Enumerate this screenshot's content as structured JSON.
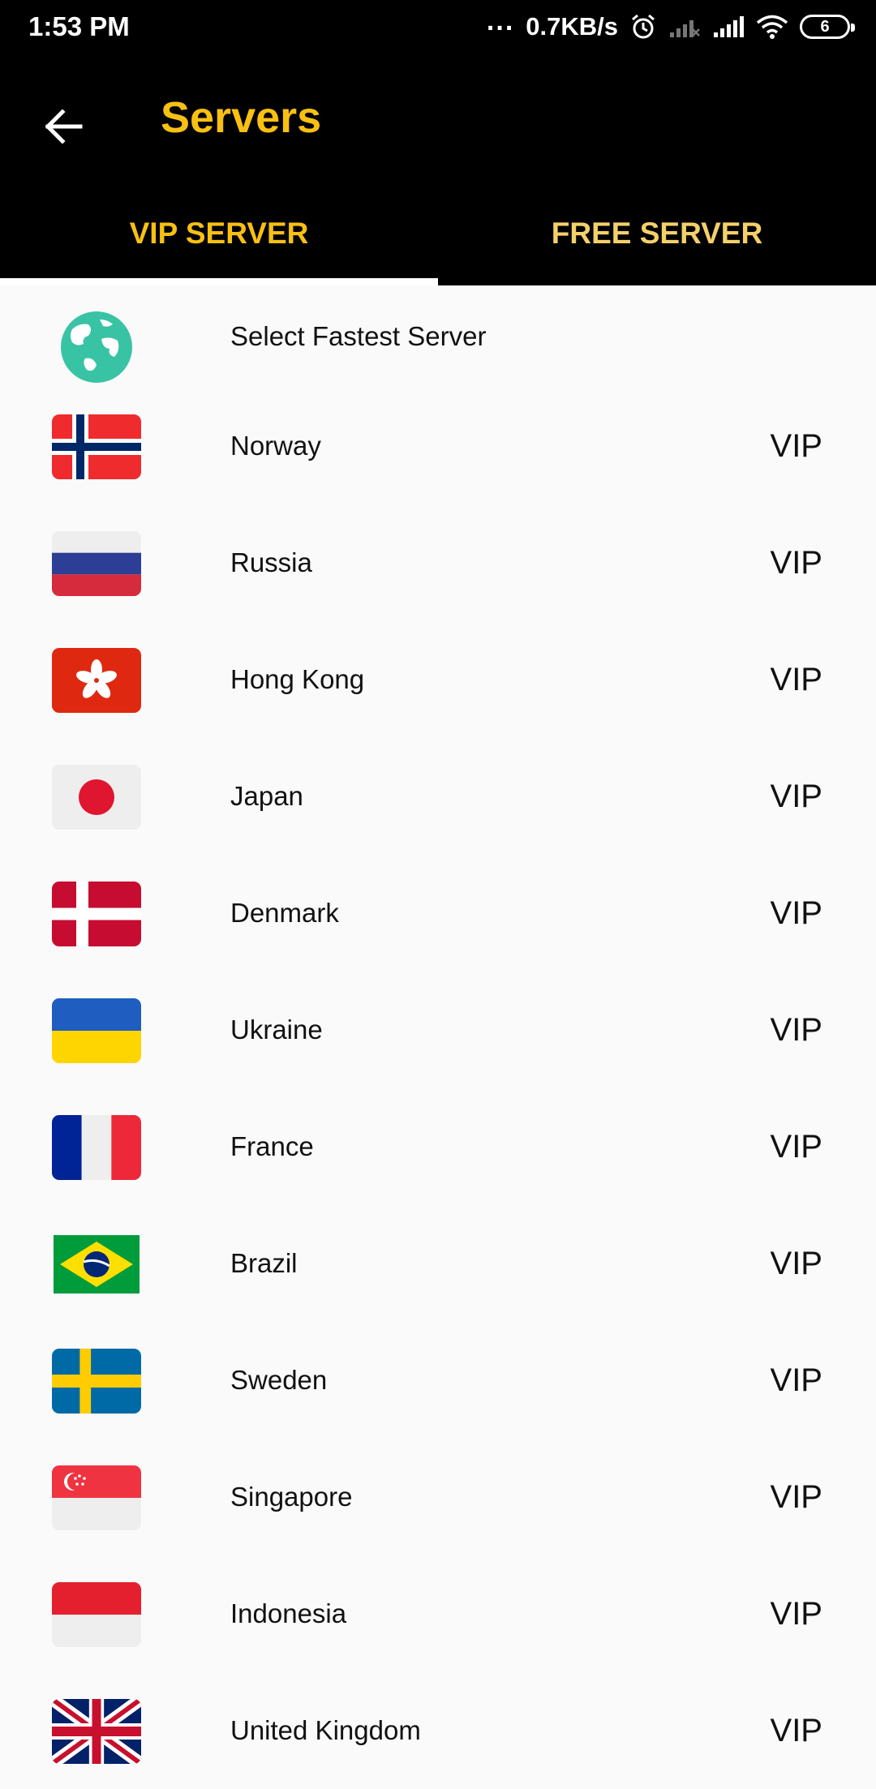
{
  "status_bar": {
    "time": "1:53 PM",
    "dots": "...",
    "speed": "0.7KB/s",
    "battery": "6"
  },
  "app_bar": {
    "back_icon": "arrow-left-icon",
    "title": "Servers"
  },
  "tabs": [
    {
      "label": "VIP SERVER",
      "selected": true
    },
    {
      "label": "FREE SERVER",
      "selected": false
    }
  ],
  "fastest": {
    "label": "Select Fastest Server",
    "icon": "globe-icon"
  },
  "servers": [
    {
      "name": "Norway",
      "tier": "VIP",
      "flag": "flag-norway-icon"
    },
    {
      "name": "Russia",
      "tier": "VIP",
      "flag": "flag-russia-icon"
    },
    {
      "name": "Hong Kong",
      "tier": "VIP",
      "flag": "flag-hong-kong-icon"
    },
    {
      "name": "Japan",
      "tier": "VIP",
      "flag": "flag-japan-icon"
    },
    {
      "name": "Denmark",
      "tier": "VIP",
      "flag": "flag-denmark-icon"
    },
    {
      "name": "Ukraine",
      "tier": "VIP",
      "flag": "flag-ukraine-icon"
    },
    {
      "name": "France",
      "tier": "VIP",
      "flag": "flag-france-icon"
    },
    {
      "name": "Brazil",
      "tier": "VIP",
      "flag": "flag-brazil-icon"
    },
    {
      "name": "Sweden",
      "tier": "VIP",
      "flag": "flag-sweden-icon"
    },
    {
      "name": "Singapore",
      "tier": "VIP",
      "flag": "flag-singapore-icon"
    },
    {
      "name": "Indonesia",
      "tier": "VIP",
      "flag": "flag-indonesia-icon"
    },
    {
      "name": "United Kingdom",
      "tier": "VIP",
      "flag": "flag-united-kingdom-icon"
    }
  ],
  "colors": {
    "accent": "#f8c012",
    "header_bg": "#000000",
    "list_bg": "#fafafa"
  }
}
